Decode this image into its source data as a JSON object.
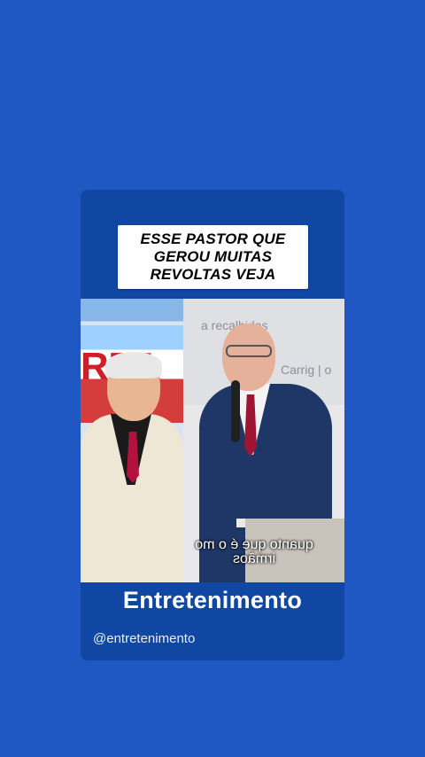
{
  "post": {
    "headline": "ESSE PASTOR QUE\nGEROU MUITAS\nREVOLTAS VEJA",
    "left_sign_text": "RTA",
    "screen_text_1": "a recalhidas",
    "screen_text_2": "Carrig | o",
    "caption_line_1": "quanto que é o mo",
    "caption_line_2": "irmãos",
    "brand": "Entretenimento",
    "handle": "@entretenimento"
  },
  "colors": {
    "background": "#1f57c3",
    "card": "#0f47a3",
    "headline_box": "#ffffff"
  }
}
